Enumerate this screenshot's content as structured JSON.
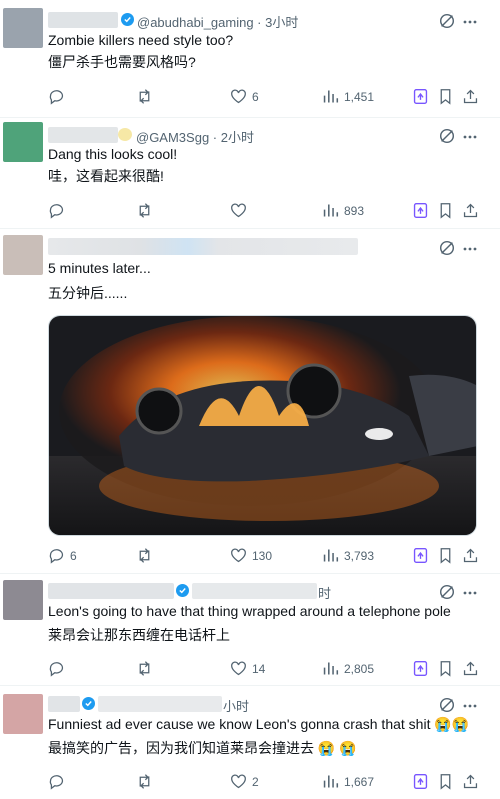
{
  "posts": [
    {
      "handle": "@abudhabi_gaming · 3小时",
      "text_en": "Zombie killers need style too?",
      "text_zh": "僵尸杀手也需要风格吗?",
      "replies": "",
      "reposts": "",
      "likes": "6",
      "views": "1,451",
      "avatar_color": "#9aa3ad"
    },
    {
      "handle": "@GAM3Sgg · 2小时",
      "text_en": "Dang this looks cool!",
      "text_zh": "哇，这看起来很酷!",
      "replies": "",
      "reposts": "",
      "likes": "",
      "views": "893",
      "avatar_color": "#4fa37a"
    },
    {
      "handle": "",
      "text_en": "5 minutes later...",
      "text_zh": "五分钟后......",
      "replies": "6",
      "reposts": "",
      "likes": "130",
      "views": "3,793",
      "avatar_color": "#c9beb8",
      "media_alt": "Overturned car on fire on a wet street at night"
    },
    {
      "handle": "时",
      "text_en": "Leon's going to have that thing wrapped around a telephone pole",
      "text_zh": "莱昂会让那东西缠在电话杆上",
      "replies": "",
      "reposts": "",
      "likes": "14",
      "views": "2,805",
      "avatar_color": "#8d8a92"
    },
    {
      "handle": "小时",
      "text_en": "Funniest ad ever cause we know Leon's gonna crash that shit 😭😭",
      "text_zh": "最搞笑的广告，因为我们知道莱昂会撞进去 😭 😭",
      "replies": "",
      "reposts": "",
      "likes": "2",
      "views": "1,667",
      "avatar_color": "#d4a5a5"
    }
  ],
  "colors": {
    "accent": "#1d9bf0",
    "grok": "#7856ff",
    "muted": "#536471",
    "divider": "#eff3f4"
  }
}
